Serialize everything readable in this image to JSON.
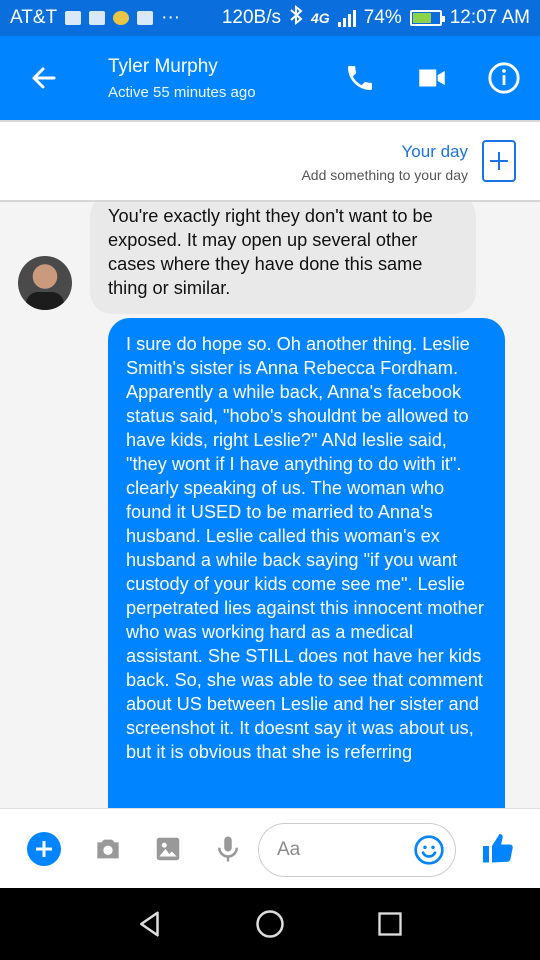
{
  "status_bar": {
    "carrier": "AT&T",
    "dots": "···",
    "speed": "120B/s",
    "network": "4G",
    "battery_percent": "74%",
    "battery_level": 0.74,
    "time": "12:07 AM"
  },
  "header": {
    "contact_name": "Tyler Murphy",
    "presence": "Active 55 minutes ago",
    "icons": {
      "back": "arrow-left-icon",
      "call": "phone-icon",
      "video": "video-camera-icon",
      "info": "info-icon"
    }
  },
  "your_day": {
    "title": "Your day",
    "subtitle": "Add something to your day"
  },
  "messages": [
    {
      "direction": "incoming",
      "text": "You're exactly right they don't want to be exposed. It may open up several other cases where they have done this same thing or similar."
    },
    {
      "direction": "outgoing",
      "text": "I sure do hope so. Oh another thing. Leslie Smith's sister is Anna Rebecca Fordham. Apparently a while back, Anna's facebook status said, \"hobo's shouldnt be allowed to have kids, right Leslie?\" ANd leslie said, \"they wont if I have anything to do with it\".    clearly speaking of us. The woman who found it USED to be married to Anna's husband. Leslie called this woman's ex husband a while back saying \"if you want custody of your kids come see me\".  Leslie perpetrated lies against this innocent mother who was working hard as a medical assistant. She STILL does not have her kids back. So, she was able to see that comment about US between Leslie and her sister and screenshot it. It doesnt say it was about us, but it is obvious that she is referring"
    }
  ],
  "composer": {
    "placeholder": "Aa",
    "icons": [
      "plus-icon",
      "camera-icon",
      "image-icon",
      "microphone-icon",
      "emoji-icon",
      "thumbs-up-icon"
    ]
  },
  "colors": {
    "brand": "#0084ff",
    "status_bar": "#0a6fdd",
    "incoming_bubble": "#e9e9e9"
  }
}
